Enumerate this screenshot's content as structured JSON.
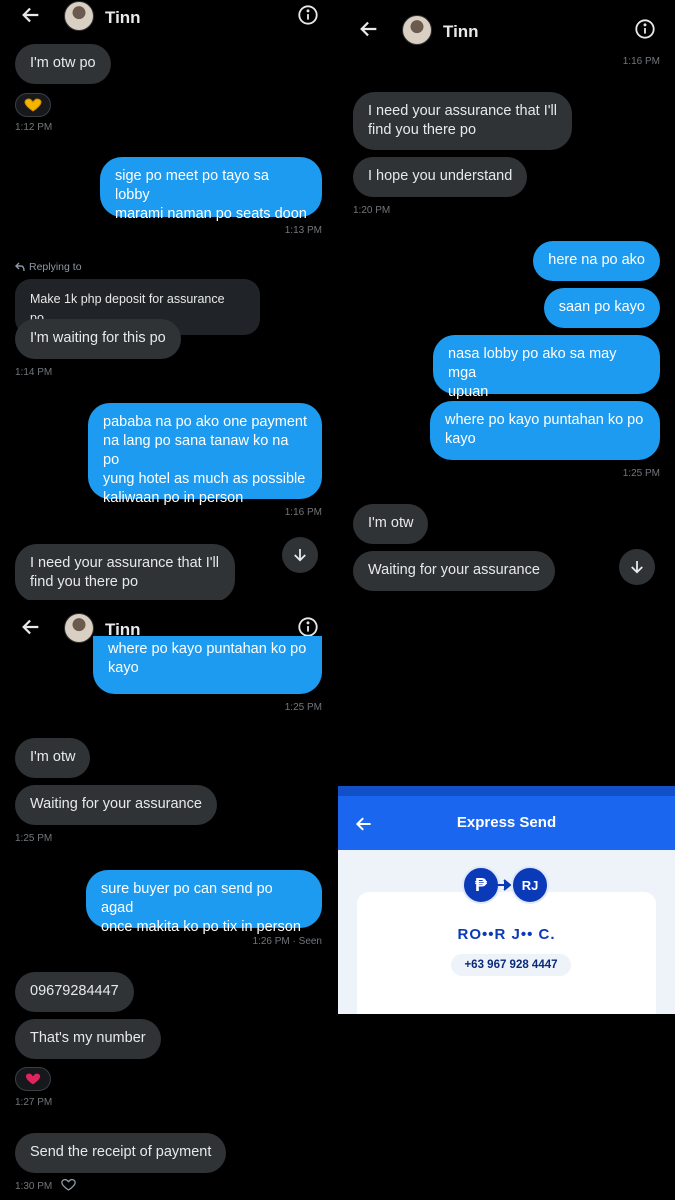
{
  "contact_name": "Tinn",
  "panel1": {
    "msg1": "I'm otw po",
    "ts1": "1:12 PM",
    "msg2": "sige po meet po tayo sa lobby\nmarami naman po seats doon",
    "ts2": "1:13 PM",
    "reply_label": "Replying to",
    "reply_quote": "Make 1k php deposit for assurance po,",
    "msg3": "I'm waiting for this po",
    "ts3": "1:14 PM",
    "msg4": "pababa na po ako one payment\nna lang po sana tanaw ko na po\nyung hotel as much as possible\nkaliwaan po in person",
    "ts4": "1:16 PM",
    "msg5": "I need your assurance that I'll\nfind you there po"
  },
  "panel2": {
    "ts0": "1:16 PM",
    "msg1": "I need your assurance that I'll\nfind you there po",
    "msg2": "I hope you understand",
    "ts1": "1:20 PM",
    "msg3": "here na po ako",
    "msg4": "saan po kayo",
    "msg5": "nasa lobby po ako sa may mga\nupuan",
    "msg6": "where po kayo puntahan ko po\nkayo",
    "ts2": "1:25 PM",
    "msg7": "I'm otw",
    "msg8": "Waiting for your assurance"
  },
  "panel3": {
    "msg0": "where po kayo puntahan ko po\nkayo",
    "ts0": "1:25 PM",
    "msg1": "I'm otw",
    "msg2": "Waiting for your assurance",
    "ts1": "1:25 PM",
    "msg3": "sure buyer po can send po agad\nonce makita ko po tix in person",
    "ts2": "1:26 PM · Seen",
    "msg4": "09679284447",
    "msg5": "That's my number",
    "ts3": "1:27 PM",
    "msg6": "Send the receipt of payment",
    "ts4": "1:30 PM"
  },
  "express_send": {
    "title": "Express Send",
    "from_symbol": "₱",
    "to_initials": "RJ",
    "recipient_name": "RO••R J•• C.",
    "recipient_phone": "+63 967 928 4447"
  },
  "icons": [
    "back-arrow-icon",
    "info-icon",
    "scroll-down-icon",
    "heart-reaction-icon",
    "heart-hands-reaction-icon",
    "reply-arrow-icon",
    "add-reaction-icon"
  ],
  "colors": {
    "outgoing": "#1d9bf0",
    "incoming": "#2f3336",
    "gcash_blue": "#1a66ee"
  }
}
